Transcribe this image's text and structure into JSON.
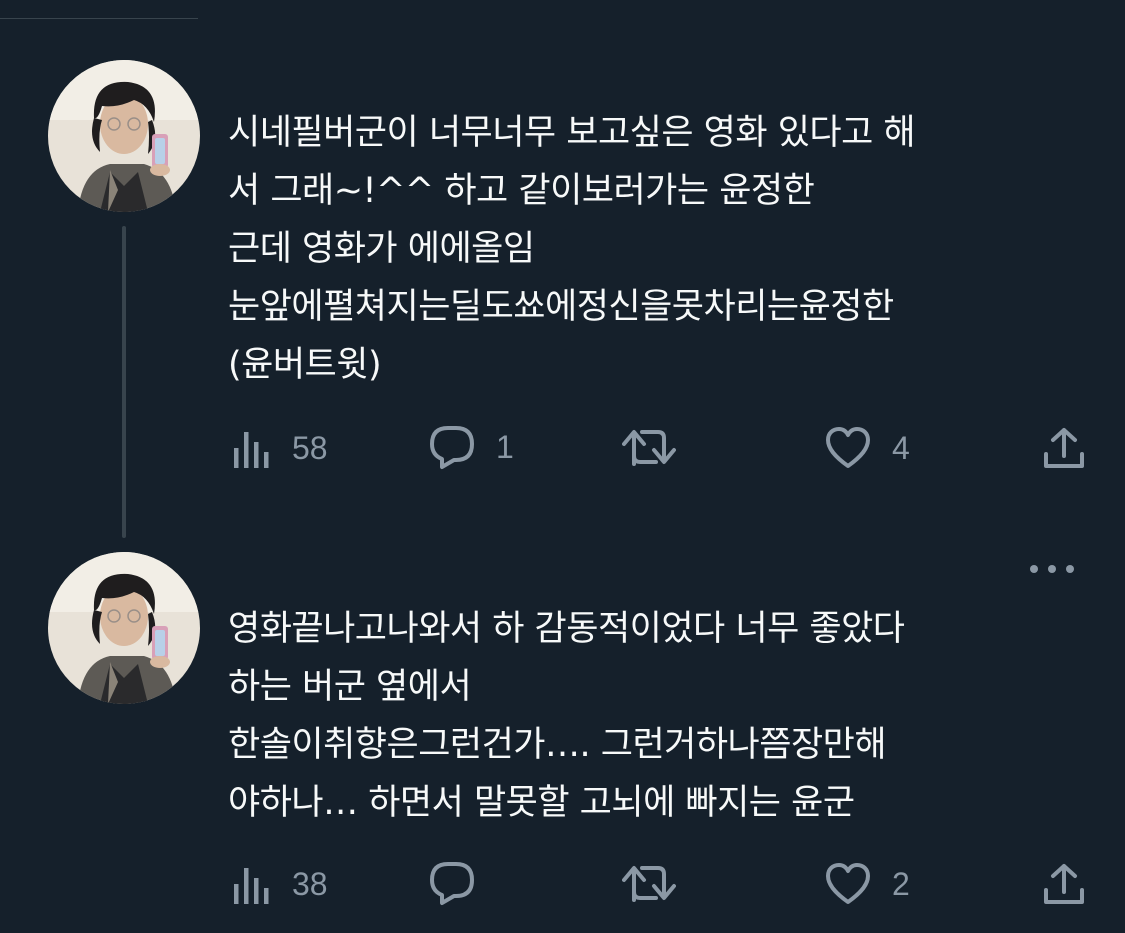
{
  "tweets": [
    {
      "text_lines": [
        "시네필버군이 너무너무 보고싶은 영화 있다고 해",
        "서 그래~!^^ 하고 같이보러가는 윤정한",
        "근데 영화가 에에올임",
        "눈앞에펼쳐지는딜도쑈에정신을못차리는윤정한",
        "(윤버트윗)"
      ],
      "views": "58",
      "replies": "1",
      "retweets": "",
      "likes": "4"
    },
    {
      "text_lines": [
        "영화끝나고나와서 하 감동적이었다 너무 좋았다",
        "하는 버군 옆에서",
        "한솔이취향은그런건가…. 그런거하나쯤장만해",
        "야하나… 하면서 말못할 고뇌에 빠지는 윤군"
      ],
      "views": "38",
      "replies": "",
      "retweets": "",
      "likes": "2"
    }
  ],
  "icons": {
    "views": "bar-chart-icon",
    "reply": "speech-bubble-icon",
    "retweet": "retweet-icon",
    "like": "heart-icon",
    "share": "share-upload-icon",
    "more": "more-dots-icon"
  },
  "colors": {
    "background": "#15202b",
    "text": "#f7f9f9",
    "muted": "#8b98a5",
    "divider": "#38444d"
  }
}
